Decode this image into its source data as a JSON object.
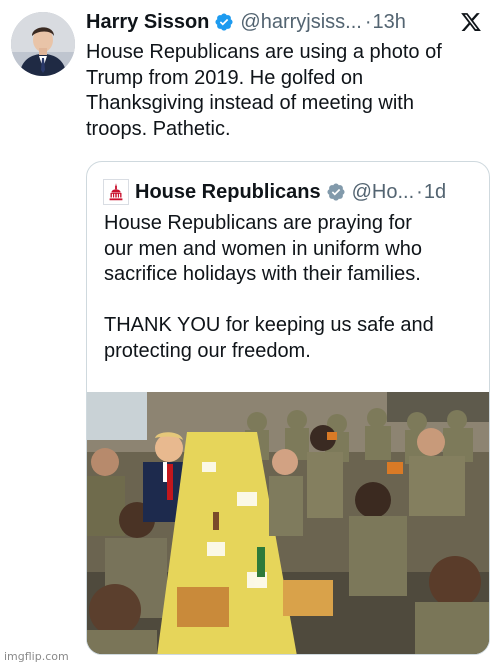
{
  "tweet": {
    "author_name": "Harry Sisson",
    "handle": "@harryjsiss...",
    "separator": "·",
    "time": "13h",
    "text_lines": [
      "House Republicans are using a photo of",
      "Trump from 2019. He golfed on",
      "Thanksgiving instead of meeting with",
      "troops. Pathetic."
    ],
    "icons": {
      "verified": "verified-badge-icon",
      "platform": "x-logo-icon"
    }
  },
  "quoted_tweet": {
    "author_name": "House Republicans",
    "handle": "@Ho...",
    "separator": "·",
    "time": "1d",
    "paragraphs": [
      [
        "House Republicans are praying for",
        "our men and women in uniform who",
        "sacrifice holidays with their families."
      ],
      [
        "THANK YOU for keeping us safe and",
        "protecting our freedom."
      ]
    ],
    "icons": {
      "avatar": "capitol-dome-logo",
      "verified": "verified-badge-icon"
    }
  },
  "watermark": "imgflip.com",
  "colors": {
    "text": "#0f1419",
    "secondary": "#536471",
    "verified_blue": "#1d9bf0",
    "border": "#cfd9de",
    "house_red": "#c8102e"
  }
}
